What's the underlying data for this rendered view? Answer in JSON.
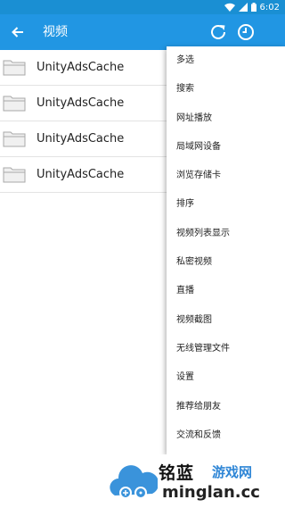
{
  "status_bar": {
    "time": "6:02",
    "icons": [
      "wifi-icon",
      "signal-icon",
      "battery-icon"
    ]
  },
  "app_bar": {
    "title": "视频",
    "back_icon": "arrow-left-icon",
    "actions": [
      "refresh-icon",
      "history-icon",
      "more-vert-icon"
    ],
    "color": "#2196e3"
  },
  "folders": [
    {
      "name": "UnityAdsCache"
    },
    {
      "name": "UnityAdsCache"
    },
    {
      "name": "UnityAdsCache"
    },
    {
      "name": "UnityAdsCache"
    }
  ],
  "menu": {
    "items": [
      {
        "label": "多选"
      },
      {
        "label": "搜索"
      },
      {
        "label": "网址播放"
      },
      {
        "label": "局域网设备"
      },
      {
        "label": "浏览存储卡"
      },
      {
        "label": "排序"
      },
      {
        "label": "视频列表显示"
      },
      {
        "label": "私密视频"
      },
      {
        "label": "直播"
      },
      {
        "label": "视频截图"
      },
      {
        "label": "无线管理文件"
      },
      {
        "label": "设置"
      },
      {
        "label": "推荐给朋友"
      },
      {
        "label": "交流和反馈"
      }
    ]
  },
  "watermark": {
    "brand": "铭蓝",
    "site": "游戏网",
    "domain": "minglan.cc"
  }
}
